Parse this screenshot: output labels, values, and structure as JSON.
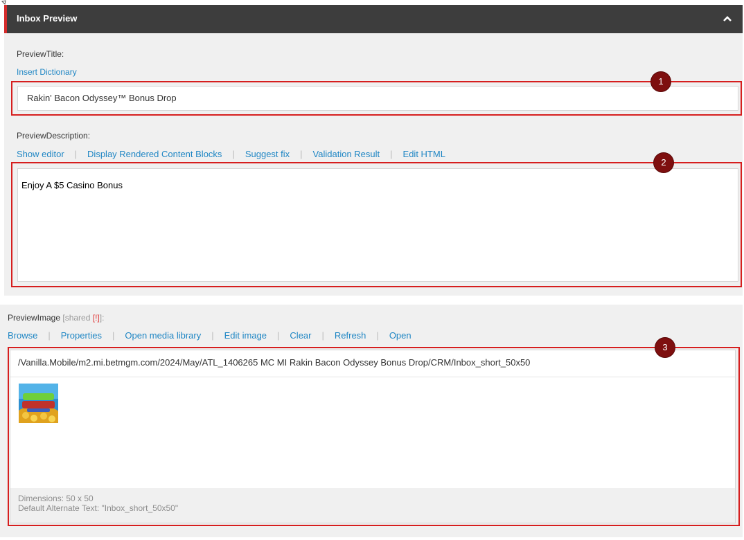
{
  "section": {
    "title": "Inbox Preview"
  },
  "preview_title": {
    "label": "PreviewTitle:",
    "link": "Insert Dictionary",
    "value": "Rakin' Bacon Odyssey™ Bonus Drop"
  },
  "preview_description": {
    "label": "PreviewDescription:",
    "links": [
      "Show editor",
      "Display Rendered Content Blocks",
      "Suggest fix",
      "Validation Result",
      "Edit HTML"
    ],
    "value": "Enjoy A $5 Casino Bonus"
  },
  "preview_image": {
    "label": "PreviewImage",
    "shared_open": "[shared ",
    "warning": "[!]",
    "shared_close": "]:",
    "links": [
      "Browse",
      "Properties",
      "Open media library",
      "Edit image",
      "Clear",
      "Refresh",
      "Open"
    ],
    "path": "/Vanilla.Mobile/m2.mi.betmgm.com/2024/May/ATL_1406265 MC MI Rakin Bacon Odyssey Bonus Drop/CRM/Inbox_short_50x50",
    "dimensions": "Dimensions: 50 x 50",
    "alt_text": "Default Alternate Text: \"Inbox_short_50x50\""
  },
  "annotations": [
    "1",
    "2",
    "3"
  ],
  "colors": {
    "header_bg": "#3d3d3d",
    "accent_red": "#d42b2b",
    "link_blue": "#1f86c4",
    "badge": "#7e0f0f"
  }
}
